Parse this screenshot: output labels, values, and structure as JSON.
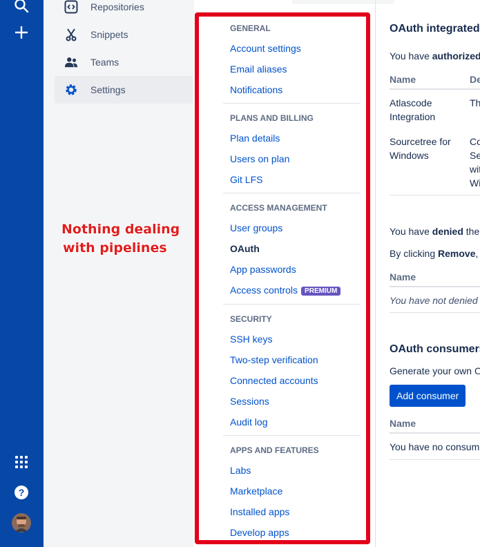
{
  "project_sidebar": {
    "items": [
      {
        "label": "Repositories",
        "icon": "repository-icon"
      },
      {
        "label": "Snippets",
        "icon": "snippets-icon"
      },
      {
        "label": "Teams",
        "icon": "teams-icon"
      },
      {
        "label": "Settings",
        "icon": "gear-icon",
        "active": true
      }
    ]
  },
  "annotation": {
    "line1": "Nothing dealing",
    "line2": "with pipelines",
    "color": "#e01e1e"
  },
  "settings_nav": {
    "general": {
      "heading": "GENERAL",
      "links": [
        "Account settings",
        "Email aliases",
        "Notifications"
      ]
    },
    "plans": {
      "heading": "PLANS AND BILLING",
      "links": [
        "Plan details",
        "Users on plan",
        "Git LFS"
      ]
    },
    "access": {
      "heading": "ACCESS MANAGEMENT",
      "links": [
        "User groups",
        "OAuth",
        "App passwords",
        "Access controls"
      ],
      "badge": "PREMIUM"
    },
    "security": {
      "heading": "SECURITY",
      "links": [
        "SSH keys",
        "Two-step verification",
        "Connected accounts",
        "Sessions",
        "Audit log"
      ]
    },
    "apps": {
      "heading": "APPS AND FEATURES",
      "links": [
        "Labs",
        "Marketplace",
        "Installed apps",
        "Develop apps"
      ]
    }
  },
  "main": {
    "integrated_heading": "OAuth integrated a",
    "authorized_prefix": "You have ",
    "authorized_bold": "authorized",
    "table1": {
      "headers": [
        "Name",
        "De"
      ],
      "rows": [
        {
          "name_l1": "Atlascode",
          "name_l2": "Integration",
          "desc": [
            "The"
          ]
        },
        {
          "name_l1": "Sourcetree for",
          "name_l2": "Windows",
          "desc": [
            "Co",
            "Sec",
            "wit",
            "Wi"
          ]
        }
      ]
    },
    "denied_prefix": "You have ",
    "denied_bold": "denied",
    "denied_suffix": " the",
    "remove_prefix": "By clicking ",
    "remove_bold": "Remove",
    "remove_suffix": ", y",
    "table2": {
      "header": "Name",
      "empty": "You have not denied"
    },
    "consumers_heading": "OAuth consumers",
    "generate_text": "Generate your own O",
    "add_consumer_label": "Add consumer",
    "table3": {
      "header": "Name",
      "empty": "You have no consum"
    }
  },
  "colors": {
    "global_nav": "#0747a6",
    "link": "#0052cc",
    "frame": "#e3001b",
    "badge": "#6554c0"
  }
}
